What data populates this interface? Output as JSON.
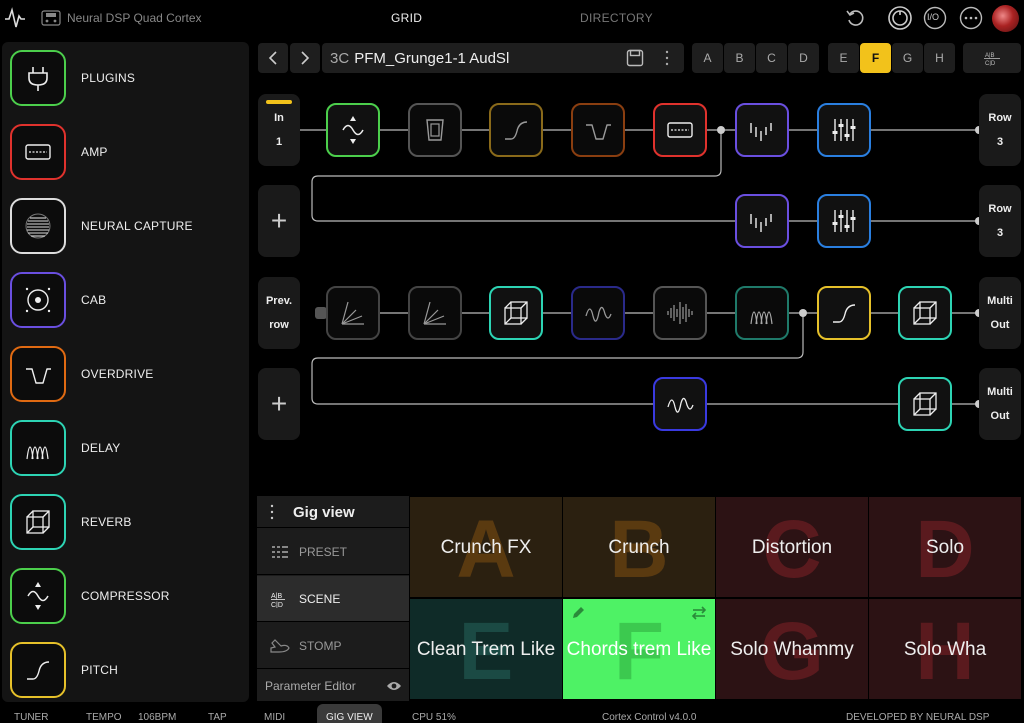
{
  "topbar": {
    "device_name": "Neural DSP Quad Cortex",
    "tabs": [
      {
        "label": "GRID"
      },
      {
        "label": "DIRECTORY"
      }
    ],
    "io_label": "I/O"
  },
  "sidebar": {
    "items": [
      {
        "label": "PLUGINS",
        "color": "#4ccf4c",
        "icon": "plug-icon"
      },
      {
        "label": "AMP",
        "color": "#e0322d",
        "icon": "amp-icon"
      },
      {
        "label": "NEURAL CAPTURE",
        "color": "#dddddd",
        "icon": "capture-icon"
      },
      {
        "label": "CAB",
        "color": "#6a4fe0",
        "icon": "speaker-icon"
      },
      {
        "label": "OVERDRIVE",
        "color": "#e06a12",
        "icon": "overdrive-icon"
      },
      {
        "label": "DELAY",
        "color": "#2dd4b4",
        "icon": "delay-icon"
      },
      {
        "label": "REVERB",
        "color": "#2dd4b4",
        "icon": "reverb-cube-icon"
      },
      {
        "label": "COMPRESSOR",
        "color": "#4ccf4c",
        "icon": "compressor-icon"
      },
      {
        "label": "PITCH",
        "color": "#e6c12a",
        "icon": "pitch-icon"
      }
    ]
  },
  "preset": {
    "prefix": "3C",
    "name": "PFM_Grunge1-1 AudSl",
    "scenes": [
      "A",
      "B",
      "C",
      "D",
      "E",
      "F",
      "G",
      "H"
    ],
    "active_scene": "F"
  },
  "grid": {
    "row1_in_top": "In",
    "row1_in_bottom": "1",
    "row1_out_top": "Row",
    "row1_out_bottom": "3",
    "row2_out_top": "Row",
    "row2_out_bottom": "3",
    "row3_in_top": "Prev.",
    "row3_in_bottom": "row",
    "row3_out_top": "Multi",
    "row3_out_bottom": "Out",
    "row4_out_top": "Multi",
    "row4_out_bottom": "Out",
    "plus_label": "+"
  },
  "gig": {
    "title": "Gig view",
    "modes": [
      {
        "label": "PRESET"
      },
      {
        "label": "SCENE"
      },
      {
        "label": "STOMP"
      }
    ],
    "active_mode": "SCENE",
    "footer": "Parameter Editor",
    "scenes": [
      {
        "letter": "A",
        "name": "Crunch FX",
        "bg": "#2b2010",
        "fg": "#5a3a10"
      },
      {
        "letter": "B",
        "name": "Crunch",
        "bg": "#2b2010",
        "fg": "#5a3a10"
      },
      {
        "letter": "C",
        "name": "Distortion",
        "bg": "#2c1214",
        "fg": "#5a1a1e"
      },
      {
        "letter": "D",
        "name": "Solo",
        "bg": "#2c1214",
        "fg": "#5a1a1e"
      },
      {
        "letter": "E",
        "name": "Clean Trem Like",
        "bg": "#0f2b28",
        "fg": "#1b4a44"
      },
      {
        "letter": "F",
        "name": "Chords trem Like",
        "bg": "#4ef265",
        "fg": "#3cc94f"
      },
      {
        "letter": "G",
        "name": "Solo Whammy",
        "bg": "#2c1214",
        "fg": "#5a1a1e"
      },
      {
        "letter": "H",
        "name": "Solo Wha",
        "bg": "#2c1214",
        "fg": "#5a1a1e"
      }
    ]
  },
  "status": {
    "tuner": "TUNER",
    "tempo_label": "TEMPO",
    "tempo_value": "106BPM",
    "tap": "TAP",
    "midi": "MIDI",
    "gig_view": "GIG VIEW",
    "cpu": "CPU 51%",
    "version": "Cortex Control v4.0.0",
    "developer": "DEVELOPED BY NEURAL DSP"
  }
}
